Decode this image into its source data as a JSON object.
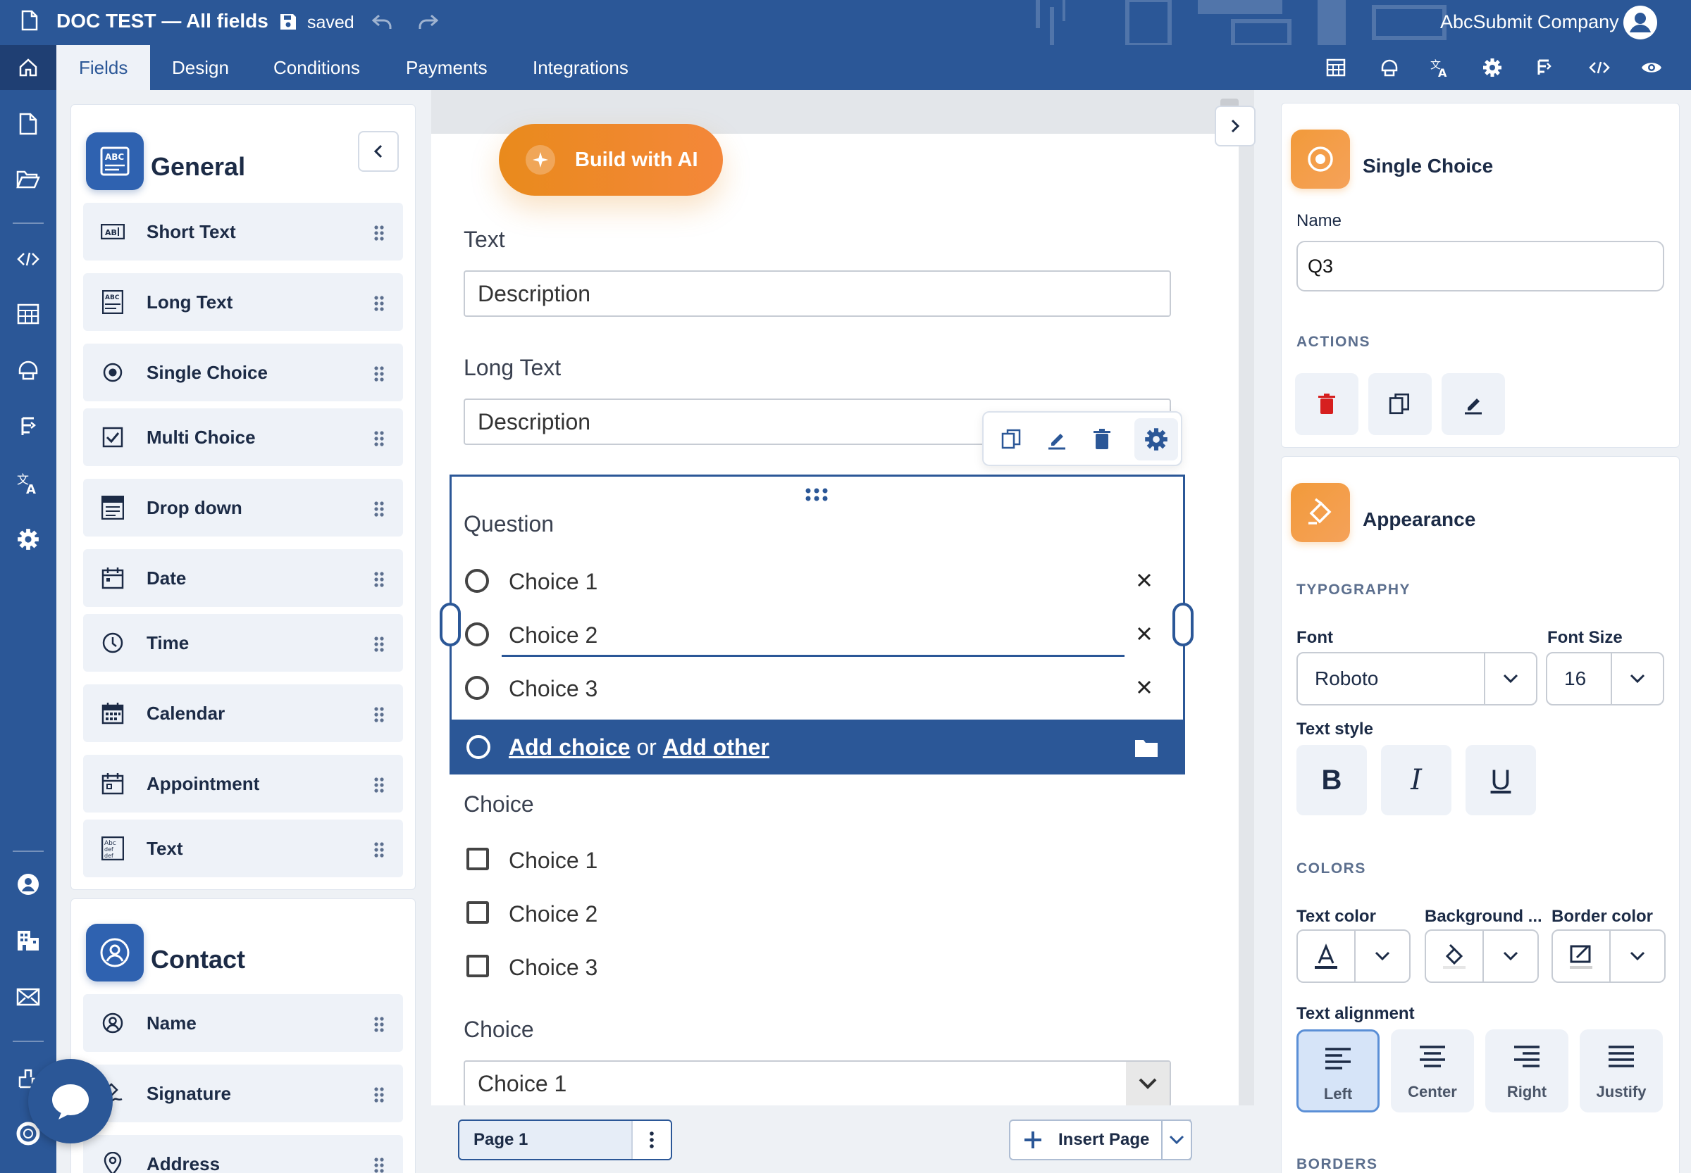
{
  "header": {
    "doc_title": "DOC TEST — All fields",
    "save_status": "saved",
    "company": "AbcSubmit Company"
  },
  "tabs": [
    "Fields",
    "Design",
    "Conditions",
    "Payments",
    "Integrations"
  ],
  "toolbar_icons": [
    "table-icon",
    "design-icon",
    "translate-icon",
    "gear-icon",
    "flow-icon",
    "code-icon",
    "eye-icon"
  ],
  "left_nav_icons": [
    "document-icon",
    "folder-icon",
    "code-icon",
    "table-icon",
    "theme-icon",
    "flow-icon",
    "translate-icon",
    "gear-icon",
    "user-icon",
    "building-icon",
    "mail-icon",
    "integration-icon",
    "support-icon"
  ],
  "groups": {
    "general": {
      "title": "General",
      "items": [
        {
          "label": "Short Text",
          "icon": "short-text-icon"
        },
        {
          "label": "Long Text",
          "icon": "long-text-icon"
        },
        {
          "label": "Single Choice",
          "icon": "radio-icon"
        },
        {
          "label": "Multi Choice",
          "icon": "checkbox-icon"
        },
        {
          "label": "Drop down",
          "icon": "dropdown-icon"
        },
        {
          "label": "Date",
          "icon": "date-icon"
        },
        {
          "label": "Time",
          "icon": "clock-icon"
        },
        {
          "label": "Calendar",
          "icon": "calendar-icon"
        },
        {
          "label": "Appointment",
          "icon": "appointment-icon"
        },
        {
          "label": "Text",
          "icon": "text-icon"
        }
      ]
    },
    "contact": {
      "title": "Contact",
      "items": [
        {
          "label": "Name",
          "icon": "user-icon"
        },
        {
          "label": "Signature",
          "icon": "signature-icon"
        },
        {
          "label": "Address",
          "icon": "pin-icon"
        }
      ]
    }
  },
  "canvas": {
    "ai_button": "Build with AI",
    "fields": [
      {
        "label": "Text",
        "placeholder": "Description"
      },
      {
        "label": "Long Text",
        "placeholder": "Description"
      }
    ],
    "question": {
      "label": "Question",
      "choices": [
        "Choice 1",
        "Choice 2",
        "Choice 3"
      ],
      "add_choice": "Add choice",
      "or": "or",
      "add_other": "Add other"
    },
    "checkbox_field": {
      "label": "Choice",
      "choices": [
        "Choice 1",
        "Choice 2",
        "Choice 3"
      ]
    },
    "dropdown_field": {
      "label": "Choice",
      "value": "Choice 1"
    },
    "page_tab": "Page 1",
    "insert_page": "Insert Page"
  },
  "properties": {
    "title": "Single Choice",
    "name_label": "Name",
    "name_value": "Q3",
    "actions_label": "ACTIONS",
    "appearance_title": "Appearance",
    "typography_label": "TYPOGRAPHY",
    "font_label": "Font",
    "font_value": "Roboto",
    "font_size_label": "Font Size",
    "font_size_value": "16",
    "text_style_label": "Text style",
    "bold": "B",
    "italic": "I",
    "underline": "U",
    "colors_label": "COLORS",
    "text_color_label": "Text color",
    "background_label": "Background ...",
    "border_color_label": "Border color",
    "alignment_label": "Text alignment",
    "alignments": [
      "Left",
      "Center",
      "Right",
      "Justify"
    ],
    "borders_label": "BORDERS"
  },
  "colors": {
    "brand": "#2b5797",
    "accent_orange": "#f29a3a",
    "delete_red": "#d61f1f"
  }
}
